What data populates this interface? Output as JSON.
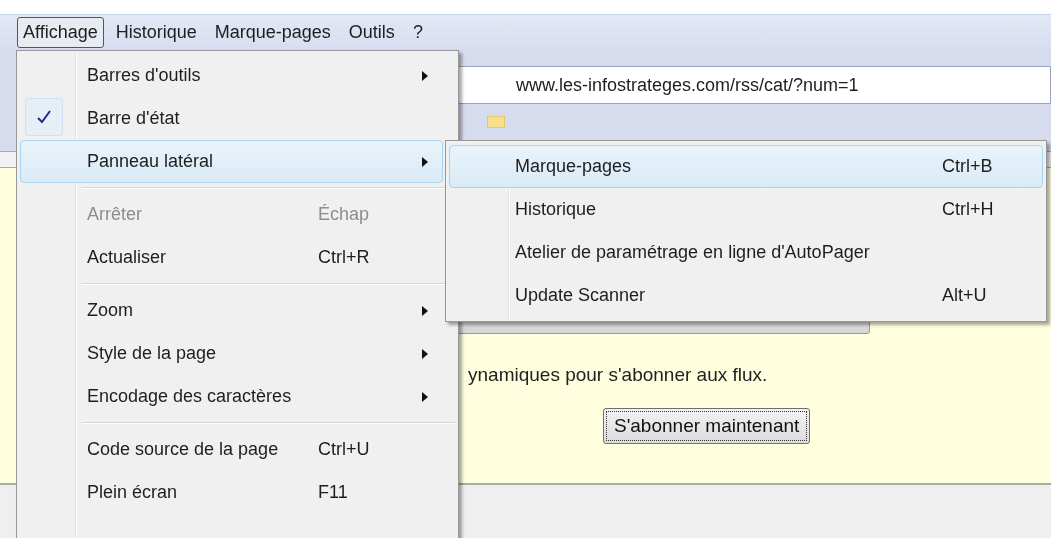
{
  "menubar": [
    {
      "label": "Affichage",
      "selected": true
    },
    {
      "label": "Historique",
      "selected": false
    },
    {
      "label": "Marque-pages",
      "selected": false
    },
    {
      "label": "Outils",
      "selected": false
    },
    {
      "label": "?",
      "selected": false
    }
  ],
  "address_bar": {
    "value": "www.les-infostrateges.com/rss/cat/?num=1"
  },
  "content": {
    "text": "ynamiques pour s'abonner aux flux.",
    "button": "S'abonner maintenant"
  },
  "menu": {
    "items": [
      {
        "kind": "item",
        "label": "Barres d'outils",
        "submenu": true,
        "checked": false,
        "disabled": false,
        "selected": false
      },
      {
        "kind": "item",
        "label": "Barre d'état",
        "submenu": false,
        "checked": true,
        "disabled": false,
        "selected": false
      },
      {
        "kind": "item",
        "label": "Panneau latéral",
        "submenu": true,
        "checked": false,
        "disabled": false,
        "selected": true
      },
      {
        "kind": "separator"
      },
      {
        "kind": "item",
        "label": "Arrêter",
        "shortcut": "Échap",
        "submenu": false,
        "checked": false,
        "disabled": true,
        "selected": false
      },
      {
        "kind": "item",
        "label": "Actualiser",
        "shortcut": "Ctrl+R",
        "submenu": false,
        "checked": false,
        "disabled": false,
        "selected": false
      },
      {
        "kind": "separator"
      },
      {
        "kind": "item",
        "label": "Zoom",
        "submenu": true,
        "checked": false,
        "disabled": false,
        "selected": false
      },
      {
        "kind": "item",
        "label": "Style de la page",
        "submenu": true,
        "checked": false,
        "disabled": false,
        "selected": false
      },
      {
        "kind": "item",
        "label": "Encodage des caractères",
        "submenu": true,
        "checked": false,
        "disabled": false,
        "selected": false
      },
      {
        "kind": "separator"
      },
      {
        "kind": "item",
        "label": "Code source de la page",
        "shortcut": "Ctrl+U",
        "submenu": false,
        "checked": false,
        "disabled": false,
        "selected": false
      },
      {
        "kind": "item",
        "label": "Plein écran",
        "shortcut": "F11",
        "submenu": false,
        "checked": false,
        "disabled": false,
        "selected": false
      }
    ]
  },
  "submenu": {
    "items": [
      {
        "kind": "item",
        "label": "Marque-pages",
        "shortcut": "Ctrl+B",
        "selected": true
      },
      {
        "kind": "item",
        "label": "Historique",
        "shortcut": "Ctrl+H",
        "selected": false
      },
      {
        "kind": "item",
        "label": "Atelier de paramétrage en ligne d'AutoPager",
        "selected": false
      },
      {
        "kind": "item",
        "label": "Update Scanner",
        "shortcut": "Alt+U",
        "selected": false
      }
    ]
  }
}
